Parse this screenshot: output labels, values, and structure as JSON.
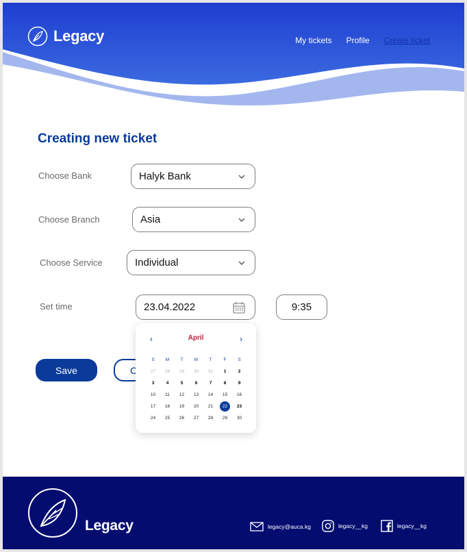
{
  "brand": {
    "name": "Legacy"
  },
  "nav": {
    "items": [
      "My tickets",
      "Profile",
      "Create ticket"
    ]
  },
  "page_title": "Creating new ticket",
  "form": {
    "bank": {
      "label": "Choose Bank",
      "value": "Halyk Bank"
    },
    "branch": {
      "label": "Choose Branch",
      "value": "Asia"
    },
    "service": {
      "label": "Choose Service",
      "value": "Individual"
    },
    "time": {
      "label": "Set time",
      "date": "23.04.2022",
      "time": "9:35"
    }
  },
  "buttons": {
    "save": "Save",
    "cancel": "C"
  },
  "calendar": {
    "prev": "‹",
    "next": "›",
    "month": "April",
    "weekdays": [
      "S",
      "M",
      "T",
      "W",
      "T",
      "F",
      "S"
    ],
    "days": [
      [
        "27",
        "28",
        "29",
        "30",
        "31",
        "1",
        "2"
      ],
      [
        "3",
        "4",
        "5",
        "6",
        "7",
        "8",
        "9"
      ],
      [
        "10",
        "11",
        "12",
        "13",
        "14",
        "15",
        "16"
      ],
      [
        "17",
        "18",
        "19",
        "20",
        "21",
        "22",
        "23"
      ],
      [
        "24",
        "25",
        "26",
        "27",
        "28",
        "29",
        "30"
      ]
    ],
    "selected": "22"
  },
  "footer": {
    "brand": "Legacy",
    "email": "legacy@auca.kg",
    "instagram": "legacy__kg",
    "facebook": "legacy__kg"
  },
  "colors": {
    "primary": "#0a3b9b",
    "footer": "#040c70",
    "month": "#c0183c"
  },
  "icons": [
    "feather-logo-icon",
    "chevron-down-icon",
    "calendar-icon",
    "mail-icon",
    "instagram-icon",
    "facebook-icon"
  ]
}
